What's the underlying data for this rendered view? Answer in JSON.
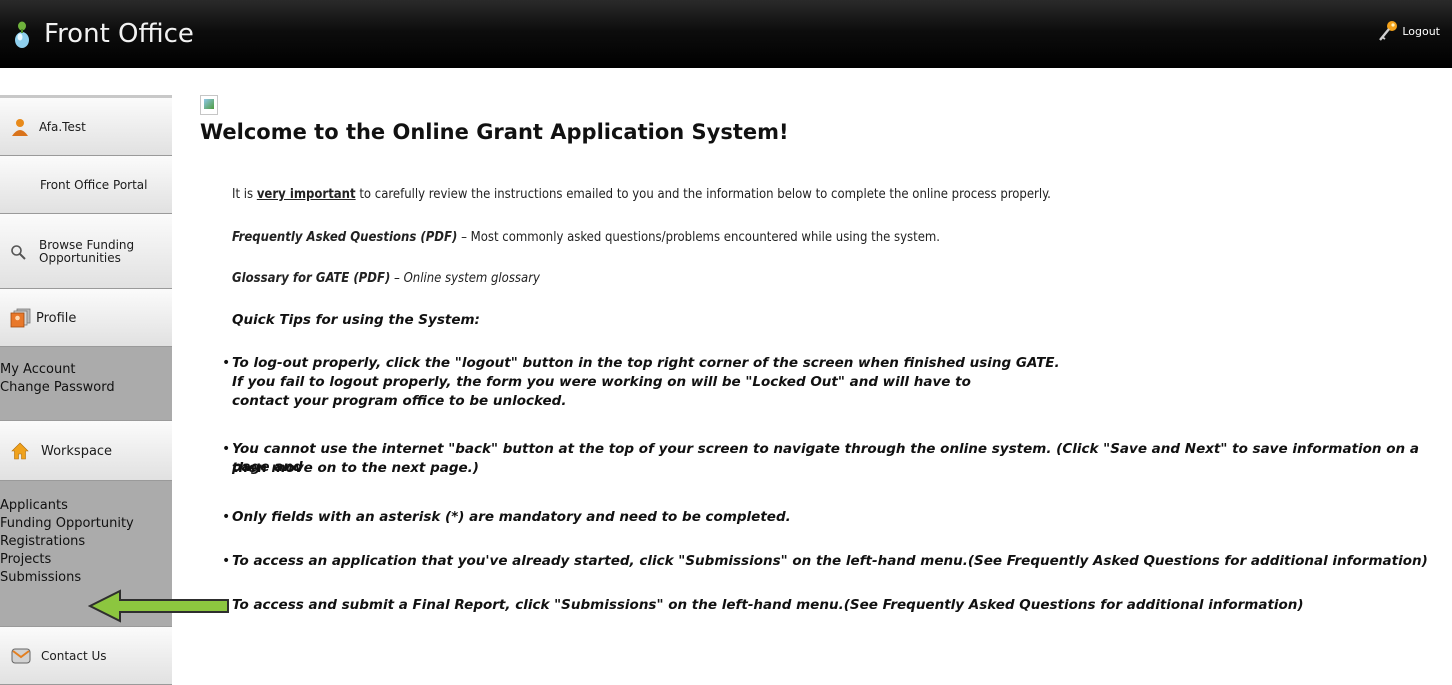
{
  "header": {
    "title": "Front Office",
    "logout_label": "Logout"
  },
  "sidebar": {
    "user": "Afa.Test",
    "portal": "Front Office Portal",
    "browse": "Browse Funding Opportunities",
    "profile": "Profile",
    "profile_links": [
      "My Account",
      "Change Password"
    ],
    "workspace": "Workspace",
    "workspace_links": [
      "Applicants",
      "Funding Opportunity Registrations",
      "Projects",
      "Submissions"
    ],
    "contact": "Contact Us"
  },
  "main": {
    "title": "Welcome to the Online Grant Application System!",
    "intro_pre": "It is ",
    "intro_em": "very important",
    "intro_post": " to carefully review the instructions emailed to you and the information below to complete the online process properly.",
    "faq_label": "Frequently Asked Questions (PDF)",
    "faq_desc": " – Most commonly asked questions/problems encountered while using the system.",
    "glossary_label": "Glossary for GATE (PDF)",
    "glossary_desc": " – Online system glossary",
    "tips_heading": "Quick Tips for using the System:",
    "tips": [
      "To log-out properly, click the \"logout\" button in the top right corner of the screen when finished using GATE.",
      "If you fail to logout properly, the form you were working on will be \"Locked Out\" and will have to",
      "contact your program office to be unlocked.",
      "You cannot use the internet \"back\" button at the top of your screen to navigate through the online system. (Click \"Save and Next\" to save information on a page and",
      "then move on to the next page.)",
      "Only fields with an asterisk (*) are mandatory and need to be completed.",
      "To access an application that you've already started, click \"Submissions\" on the left-hand menu.(See Frequently Asked Questions for additional information)",
      "To access and submit a Final Report, click \"Submissions\" on the left-hand menu.(See Frequently Asked Questions for additional information)"
    ]
  },
  "colors": {
    "arrow_fill": "#8cc63f",
    "arrow_stroke": "#2e2e2e",
    "header_bg": "#000000",
    "sidebar_dark": "#ababab"
  }
}
